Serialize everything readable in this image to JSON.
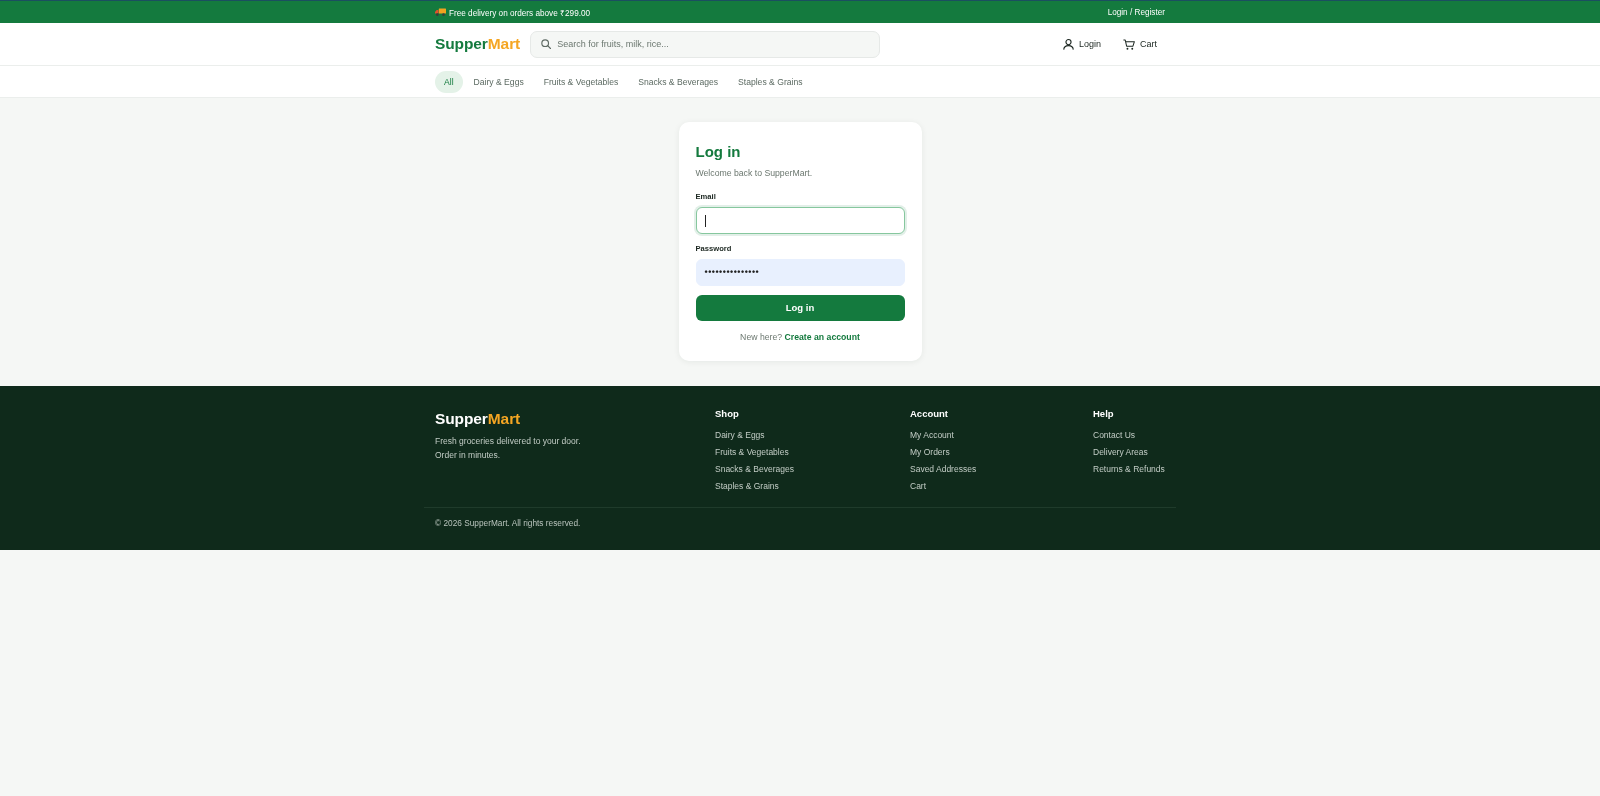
{
  "top_bar": {
    "promo": "Free delivery on orders above ₹299.00",
    "account_link": "Login / Register"
  },
  "header": {
    "logo": {
      "primary": "Supper",
      "accent": "Mart"
    },
    "search": {
      "placeholder": "Search for fruits, milk, rice..."
    },
    "actions": [
      {
        "kind": "account",
        "label": "Login"
      },
      {
        "kind": "cart",
        "label": "Cart"
      }
    ]
  },
  "categories": [
    {
      "label": "All",
      "selected": true
    },
    {
      "label": "Dairy & Eggs",
      "selected": false
    },
    {
      "label": "Fruits & Vegetables",
      "selected": false
    },
    {
      "label": "Snacks & Beverages",
      "selected": false
    },
    {
      "label": "Staples & Grains",
      "selected": false
    }
  ],
  "login_card": {
    "title": "Log in",
    "subtitle": "Welcome back to SupperMart.",
    "fields": [
      {
        "label": "Email",
        "focused": true,
        "autofilled": false
      },
      {
        "label": "Password",
        "value": "•••••••••••••••",
        "focused": false,
        "autofilled": true
      }
    ],
    "button": "Log in",
    "signup": {
      "prompt": "New here?",
      "link": "Create an account"
    }
  },
  "footer": {
    "logo": {
      "primary": "Supper",
      "accent": "Mart"
    },
    "tagline": "Fresh groceries delivered to your door. Order in minutes.",
    "columns": [
      {
        "heading": "Shop",
        "links": [
          "Dairy & Eggs",
          "Fruits & Vegetables",
          "Snacks & Beverages",
          "Staples & Grains"
        ]
      },
      {
        "heading": "Account",
        "links": [
          "My Account",
          "My Orders",
          "Saved Addresses",
          "Cart"
        ]
      },
      {
        "heading": "Help",
        "links": [
          "Contact Us",
          "Delivery Areas",
          "Returns & Refunds"
        ]
      }
    ],
    "copyright": "© 2026 SupperMart. All rights reserved."
  }
}
